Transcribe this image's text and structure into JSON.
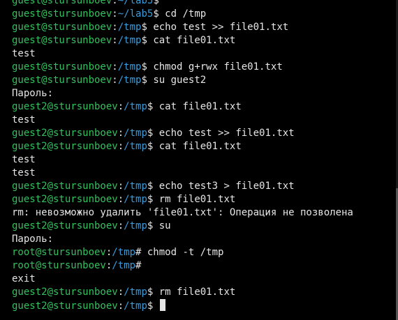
{
  "terminal": {
    "lines": [
      {
        "kind": "prompt",
        "user": "guest@stursunboev",
        "path": "~/lab5",
        "symbol": "$",
        "command": ""
      },
      {
        "kind": "prompt",
        "user": "guest@stursunboev",
        "path": "~/lab5",
        "symbol": "$",
        "command": " cd /tmp"
      },
      {
        "kind": "prompt",
        "user": "guest@stursunboev",
        "path": "/tmp",
        "symbol": "$",
        "command": " echo test >> file01.txt"
      },
      {
        "kind": "prompt",
        "user": "guest@stursunboev",
        "path": "/tmp",
        "symbol": "$",
        "command": " cat file01.txt"
      },
      {
        "kind": "output",
        "text": "test"
      },
      {
        "kind": "prompt",
        "user": "guest@stursunboev",
        "path": "/tmp",
        "symbol": "$",
        "command": " chmod g+rwx file01.txt"
      },
      {
        "kind": "prompt",
        "user": "guest@stursunboev",
        "path": "/tmp",
        "symbol": "$",
        "command": " su guest2"
      },
      {
        "kind": "output",
        "text": "Пароль:"
      },
      {
        "kind": "prompt",
        "user": "guest2@stursunboev",
        "path": "/tmp",
        "symbol": "$",
        "command": " cat file01.txt"
      },
      {
        "kind": "output",
        "text": "test"
      },
      {
        "kind": "prompt",
        "user": "guest2@stursunboev",
        "path": "/tmp",
        "symbol": "$",
        "command": " echo test >> file01.txt"
      },
      {
        "kind": "prompt",
        "user": "guest2@stursunboev",
        "path": "/tmp",
        "symbol": "$",
        "command": " cat file01.txt"
      },
      {
        "kind": "output",
        "text": "test"
      },
      {
        "kind": "output",
        "text": "test"
      },
      {
        "kind": "prompt",
        "user": "guest2@stursunboev",
        "path": "/tmp",
        "symbol": "$",
        "command": " echo test3 > file01.txt"
      },
      {
        "kind": "prompt",
        "user": "guest2@stursunboev",
        "path": "/tmp",
        "symbol": "$",
        "command": " rm file01.txt"
      },
      {
        "kind": "output",
        "text": "rm: невозможно удалить 'file01.txt': Операция не позволена"
      },
      {
        "kind": "prompt",
        "user": "guest2@stursunboev",
        "path": "/tmp",
        "symbol": "$",
        "command": " su"
      },
      {
        "kind": "output",
        "text": "Пароль:"
      },
      {
        "kind": "prompt",
        "user": "root@stursunboev",
        "path": "/tmp",
        "symbol": "#",
        "command": " chmod -t /tmp"
      },
      {
        "kind": "prompt",
        "user": "root@stursunboev",
        "path": "/tmp",
        "symbol": "#",
        "command": ""
      },
      {
        "kind": "output",
        "text": "exit"
      },
      {
        "kind": "prompt",
        "user": "guest2@stursunboev",
        "path": "/tmp",
        "symbol": "$",
        "command": " rm file01.txt"
      },
      {
        "kind": "prompt",
        "user": "guest2@stursunboev",
        "path": "/tmp",
        "symbol": "$",
        "command": " ",
        "cursor": true
      }
    ],
    "colors": {
      "background": "#000000",
      "prompt_user": "#33c15e",
      "prompt_path": "#3b9bdb",
      "text": "#e6e6e6"
    }
  }
}
